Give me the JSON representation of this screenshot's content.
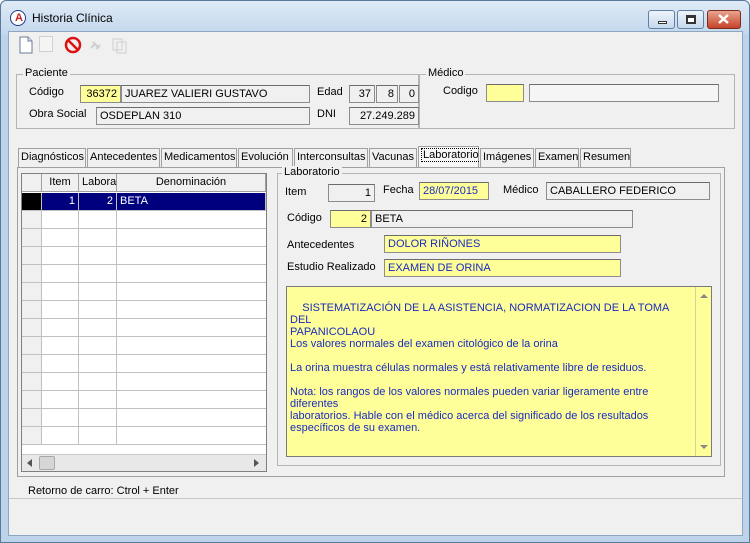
{
  "window": {
    "title": "Historia Clínica"
  },
  "paciente": {
    "group_label": "Paciente",
    "codigo_label": "Código",
    "codigo_value": "36372",
    "nombre_value": "JUAREZ VALIERI GUSTAVO",
    "edad_label": "Edad",
    "edad_years": "37",
    "edad_months": "8",
    "edad_days": "0",
    "obra_social_label": "Obra Social",
    "obra_social_value": "OSDEPLAN 310",
    "dni_label": "DNI",
    "dni_value": "27.249.289"
  },
  "medico": {
    "group_label": "Médico",
    "codigo_label": "Codigo",
    "codigo_value": "",
    "nombre_value": ""
  },
  "tabs": [
    {
      "label": "Diagnósticos"
    },
    {
      "label": "Antecedentes"
    },
    {
      "label": "Medicamentos"
    },
    {
      "label": "Evolución"
    },
    {
      "label": "Interconsultas"
    },
    {
      "label": "Vacunas"
    },
    {
      "label": "Laboratorio"
    },
    {
      "label": "Imágenes"
    },
    {
      "label": "Examen"
    },
    {
      "label": "Resumen"
    }
  ],
  "grid": {
    "headers": [
      "Item",
      "Labora",
      "Denominación"
    ],
    "rows": [
      {
        "item": "1",
        "labora": "2",
        "denominacion": "BETA"
      }
    ]
  },
  "laboratorio": {
    "group_label": "Laboratorio",
    "item_label": "Item",
    "item_value": "1",
    "fecha_label": "Fecha",
    "fecha_value": "28/07/2015",
    "medico_label": "Médico",
    "medico_value": "CABALLERO FEDERICO",
    "codigo_label": "Código",
    "codigo_value": "2",
    "codigo_name": "BETA",
    "antecedentes_label": "Antecedentes",
    "antecedentes_value": "DOLOR RIÑONES",
    "estudio_label": "Estudio Realizado",
    "estudio_value": "EXAMEN DE ORINA",
    "memo_text": "SISTEMATIZACIÓN DE LA ASISTENCIA, NORMATIZACION DE LA TOMA DEL\nPAPANICOLAOU\nLos valores normales del examen citológico de la orina\n\nLa orina muestra células normales y está relativamente libre de residuos.\n\nNota: los rangos de los valores normales pueden variar ligeramente entre diferentes\nlaboratorios. Hable con el médico acerca del significado de los resultados\nespecíficos de su examen."
  },
  "status": {
    "hint": "Retorno de carro: Ctrol + Enter"
  },
  "colors": {
    "accent_yellow": "#ffff99",
    "selection": "#00007f",
    "close_red": "#c7432a"
  },
  "icons": [
    "new-document-icon",
    "blank-icon",
    "delete-icon",
    "link-icon",
    "copy-icon"
  ]
}
